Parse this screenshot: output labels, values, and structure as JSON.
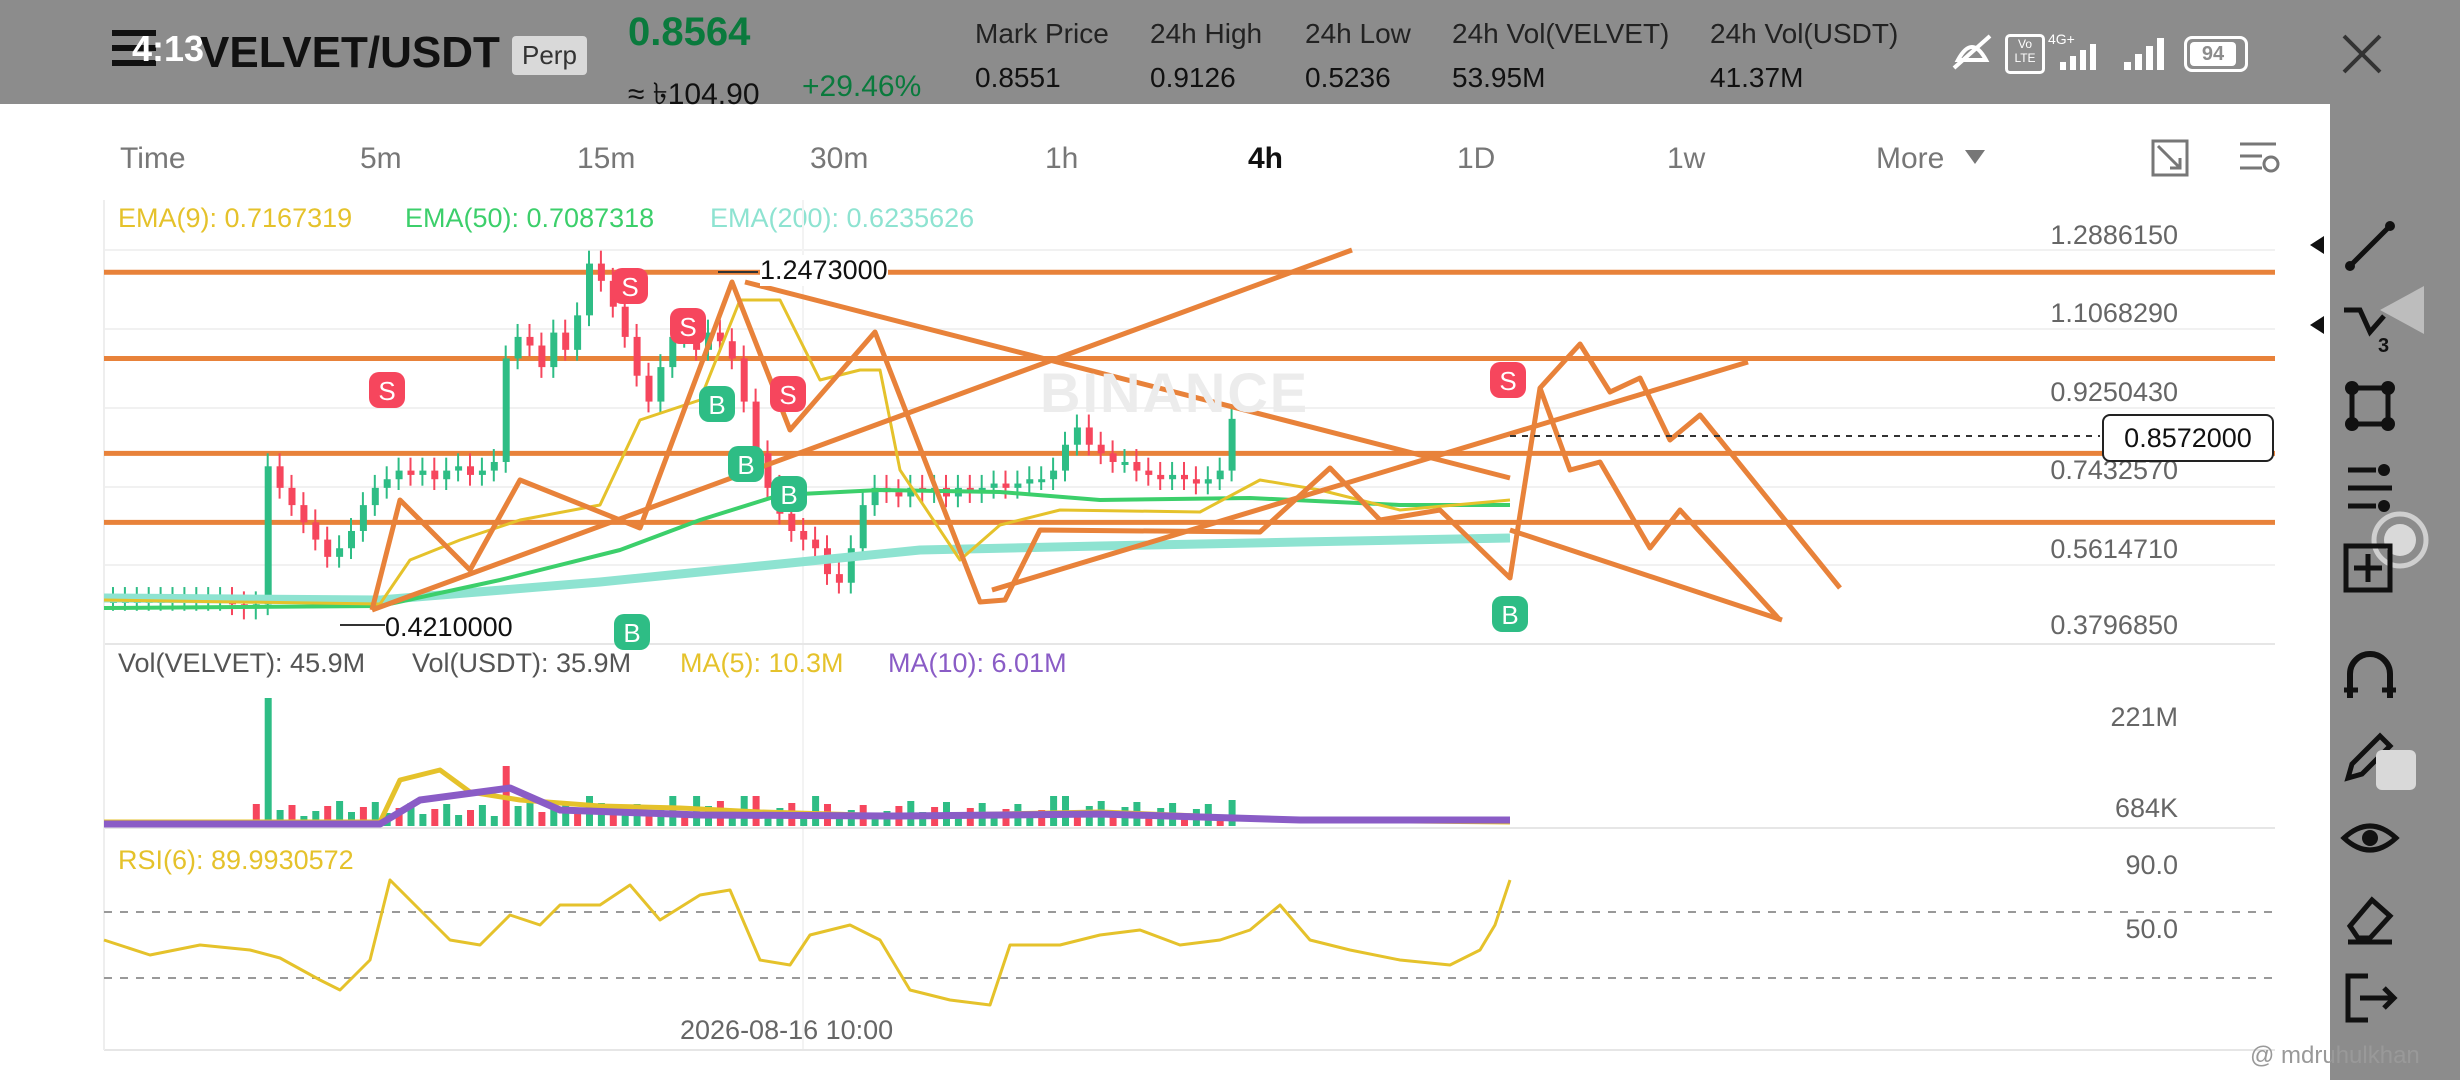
{
  "status_bar": {
    "time": "4:13",
    "battery": "94"
  },
  "header": {
    "pair": "VELVET/USDT",
    "contract": "Perp",
    "last_price": "0.8564",
    "fiat_price": "≈ ৳104.90",
    "change": "+29.46%",
    "stats": [
      {
        "label": "Mark Price",
        "value": "0.8551"
      },
      {
        "label": "24h High",
        "value": "0.9126"
      },
      {
        "label": "24h Low",
        "value": "0.5236"
      },
      {
        "label": "24h Vol(VELVET)",
        "value": "53.95M"
      },
      {
        "label": "24h Vol(USDT)",
        "value": "41.37M"
      }
    ]
  },
  "timeframes": [
    "Time",
    "5m",
    "15m",
    "30m",
    "1h",
    "4h",
    "1D",
    "1w",
    "More"
  ],
  "active_timeframe": "4h",
  "main_legend": {
    "ema9": "EMA(9): 0.7167319",
    "ema50": "EMA(50): 0.7087318",
    "ema200": "EMA(200): 0.6235626"
  },
  "price_axis": [
    "1.2886150",
    "1.1068290",
    "0.9250430",
    "0.7432570",
    "0.5614710",
    "0.3796850"
  ],
  "current_price_tag": "0.8572000",
  "high_marker": "1.2473000",
  "low_marker": "0.4210000",
  "watermark": "BINANCE",
  "volume_legend": {
    "vol_base": "Vol(VELVET): 45.9M",
    "vol_quote": "Vol(USDT): 35.9M",
    "ma5": "MA(5): 10.3M",
    "ma10": "MA(10): 6.01M"
  },
  "volume_axis": [
    "221M",
    "684K"
  ],
  "rsi_legend": "RSI(6): 89.9930572",
  "rsi_axis": [
    "90.0",
    "50.0"
  ],
  "time_label": "2026-08-16 10:00",
  "user_watermark": "@ mdruhulkhan",
  "colors": {
    "up": "#2ebd85",
    "down": "#f6465d",
    "drawing": "#e8823a",
    "ema9": "#e5c22b",
    "ema50": "#3ccf6b",
    "ema200": "#8ee3d1",
    "ma10": "#8a5cc6"
  },
  "toolbar_icons": [
    "trend-line-icon",
    "multi-line-icon",
    "shape-icon",
    "fib-icon",
    "measure-icon",
    "magnet-icon",
    "pencil-icon",
    "eye-icon",
    "eraser-icon",
    "exit-icon"
  ]
}
